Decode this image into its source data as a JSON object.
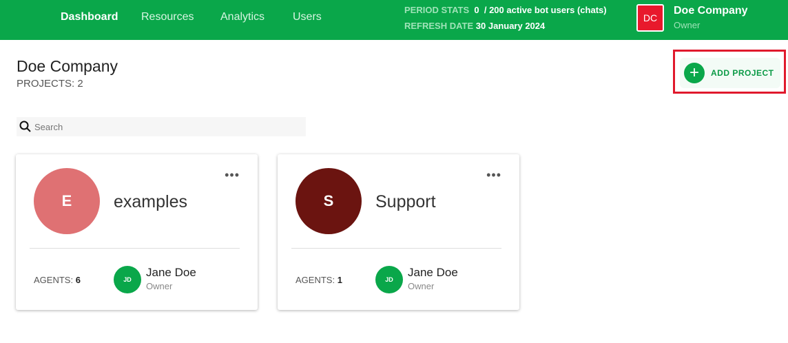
{
  "nav": {
    "items": [
      {
        "label": "Dashboard"
      },
      {
        "label": "Resources"
      },
      {
        "label": "Analytics"
      },
      {
        "label": "Users"
      }
    ]
  },
  "stats": {
    "period_label": "PERIOD STATS",
    "period_value": "0",
    "period_suffix": "/ 200 active bot users (chats)",
    "refresh_label": "REFRESH DATE",
    "refresh_value": "30 January 2024"
  },
  "account": {
    "initials": "DC",
    "name": "Doe Company",
    "role": "Owner"
  },
  "page": {
    "title": "Doe Company",
    "projects_count": "PROJECTS: 2",
    "add_label": "ADD PROJECT",
    "search_placeholder": "Search"
  },
  "projects": [
    {
      "initial": "E",
      "name": "examples",
      "color": "#df7173",
      "agents_label": "AGENTS:",
      "agents": "6",
      "user_initials": "JD",
      "user_name": "Jane Doe",
      "user_role": "Owner"
    },
    {
      "initial": "S",
      "name": "Support",
      "color": "#6b1410",
      "agents_label": "AGENTS:",
      "agents": "1",
      "user_initials": "JD",
      "user_name": "Jane Doe",
      "user_role": "Owner"
    }
  ]
}
